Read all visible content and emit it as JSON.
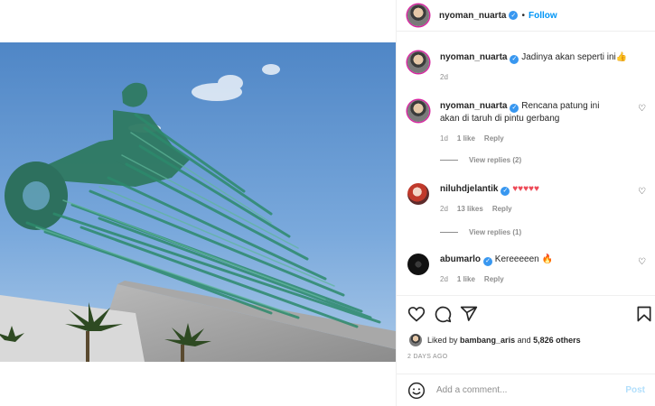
{
  "header": {
    "username": "nyoman_nuarta",
    "separator": "•",
    "follow_label": "Follow"
  },
  "comments": [
    {
      "username": "nyoman_nuarta",
      "verified": true,
      "text": "Jadinya akan seperti ini👍",
      "time": "2d",
      "likes": "",
      "reply": ""
    },
    {
      "username": "nyoman_nuarta",
      "verified": true,
      "text": "Rencana patung ini akan di taruh di pintu gerbang",
      "time": "1d",
      "likes": "1 like",
      "reply": "Reply",
      "view_replies": "View replies (2)"
    },
    {
      "username": "niluhdjelantik",
      "verified": true,
      "text": "♥♥♥♥♥",
      "time": "2d",
      "likes": "13 likes",
      "reply": "Reply",
      "view_replies": "View replies (1)"
    },
    {
      "username": "abumarlo",
      "verified": true,
      "text": "Kereeeeen 🔥",
      "time": "2d",
      "likes": "1 like",
      "reply": "Reply"
    }
  ],
  "likes": {
    "prefix": "Liked by",
    "user": "bambang_aris",
    "and": "and",
    "others": "5,826 others"
  },
  "timestamp": "2 DAYS AGO",
  "add_comment": {
    "placeholder": "Add a comment...",
    "post_label": "Post"
  },
  "icons": {
    "like": "heart-icon",
    "comment": "comment-icon",
    "share": "paper-plane-icon",
    "save": "bookmark-icon",
    "emoji": "smiley-icon",
    "verified": "verified-badge-icon"
  },
  "colors": {
    "accent": "#0095f6",
    "verified": "#3897f0",
    "text": "#262626",
    "muted": "#8e8e8e",
    "heart_red": "#ed4956",
    "post_disabled": "#b2dffc"
  }
}
